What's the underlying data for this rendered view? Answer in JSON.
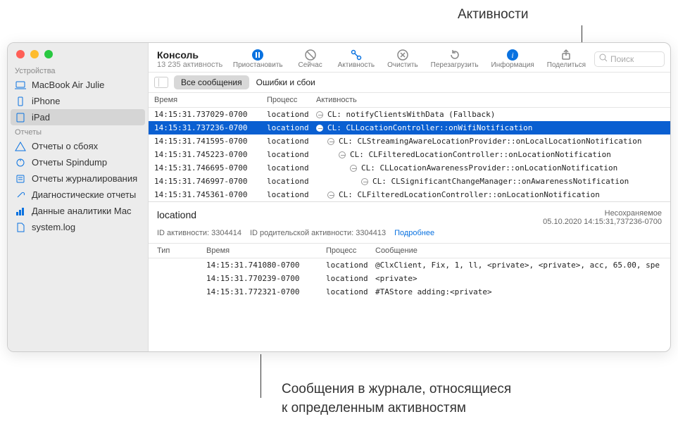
{
  "annotations": {
    "top": "Активности",
    "bottom_line1": "Сообщения в журнале, относящиеся",
    "bottom_line2": "к определенным активностям"
  },
  "window": {
    "title": "Консоль",
    "subtitle": "13 235 активность"
  },
  "toolbar": {
    "pause": "Приостановить",
    "now": "Сейчас",
    "activity": "Активность",
    "clear": "Очистить",
    "reload": "Перезагрузить",
    "info": "Информация",
    "share": "Поделиться",
    "search_placeholder": "Поиск"
  },
  "filterbar": {
    "all_messages": "Все сообщения",
    "errors_faults": "Ошибки и сбои"
  },
  "sidebar": {
    "devices_label": "Устройства",
    "devices": [
      {
        "label": "MacBook Air Julie",
        "icon": "laptop"
      },
      {
        "label": "iPhone",
        "icon": "phone"
      },
      {
        "label": "iPad",
        "icon": "tablet"
      }
    ],
    "reports_label": "Отчеты",
    "reports": [
      {
        "label": "Отчеты о сбоях",
        "icon": "warning"
      },
      {
        "label": "Отчеты Spindump",
        "icon": "spin"
      },
      {
        "label": "Отчеты журналирования",
        "icon": "journal"
      },
      {
        "label": "Диагностические отчеты",
        "icon": "wrench"
      },
      {
        "label": "Данные аналитики Мас",
        "icon": "chart"
      },
      {
        "label": "system.log",
        "icon": "file"
      }
    ]
  },
  "columns": {
    "time": "Время",
    "process": "Процесс",
    "activity": "Активность"
  },
  "rows": [
    {
      "time": "14:15:31.737029-0700",
      "process": "locationd",
      "indent": 0,
      "activity": "CL: notifyClientsWithData (Fallback)"
    },
    {
      "time": "14:15:31.737236-0700",
      "process": "locationd",
      "indent": 0,
      "activity": "CL: CLLocationController::onWifiNotification",
      "selected": true
    },
    {
      "time": "14:15:31.741595-0700",
      "process": "locationd",
      "indent": 1,
      "activity": "CL: CLStreamingAwareLocationProvider::onLocalLocationNotification"
    },
    {
      "time": "14:15:31.745223-0700",
      "process": "locationd",
      "indent": 2,
      "activity": "CL: CLFilteredLocationController::onLocationNotification"
    },
    {
      "time": "14:15:31.746695-0700",
      "process": "locationd",
      "indent": 3,
      "activity": "CL: CLLocationAwarenessProvider::onLocationNotification"
    },
    {
      "time": "14:15:31.746997-0700",
      "process": "locationd",
      "indent": 4,
      "activity": "CL: CLSignificantChangeManager::onAwarenessNotification"
    },
    {
      "time": "14:15:31.745361-0700",
      "process": "locationd",
      "indent": 1,
      "activity": "CL: CLFilteredLocationController::onLocationNotification"
    }
  ],
  "detail": {
    "title": "locationd",
    "activity_id_label": "ID активности:",
    "activity_id": "3304414",
    "parent_id_label": "ID родительской активности:",
    "parent_id": "3304413",
    "more": "Подробнее",
    "status": "Несохраняемое",
    "timestamp": "05.10.2020 14:15:31,737236-0700",
    "columns": {
      "type": "Тип",
      "time": "Время",
      "process": "Процесс",
      "message": "Сообщение"
    },
    "rows": [
      {
        "time": "14:15:31.741080-0700",
        "process": "locationd",
        "message": "@ClxClient, Fix, 1, ll, <private>, <private>, acc, 65.00, spe"
      },
      {
        "time": "14:15:31.770239-0700",
        "process": "locationd",
        "message": "<private>"
      },
      {
        "time": "14:15:31.772321-0700",
        "process": "locationd",
        "message": "#TAStore adding:<private>"
      }
    ]
  }
}
